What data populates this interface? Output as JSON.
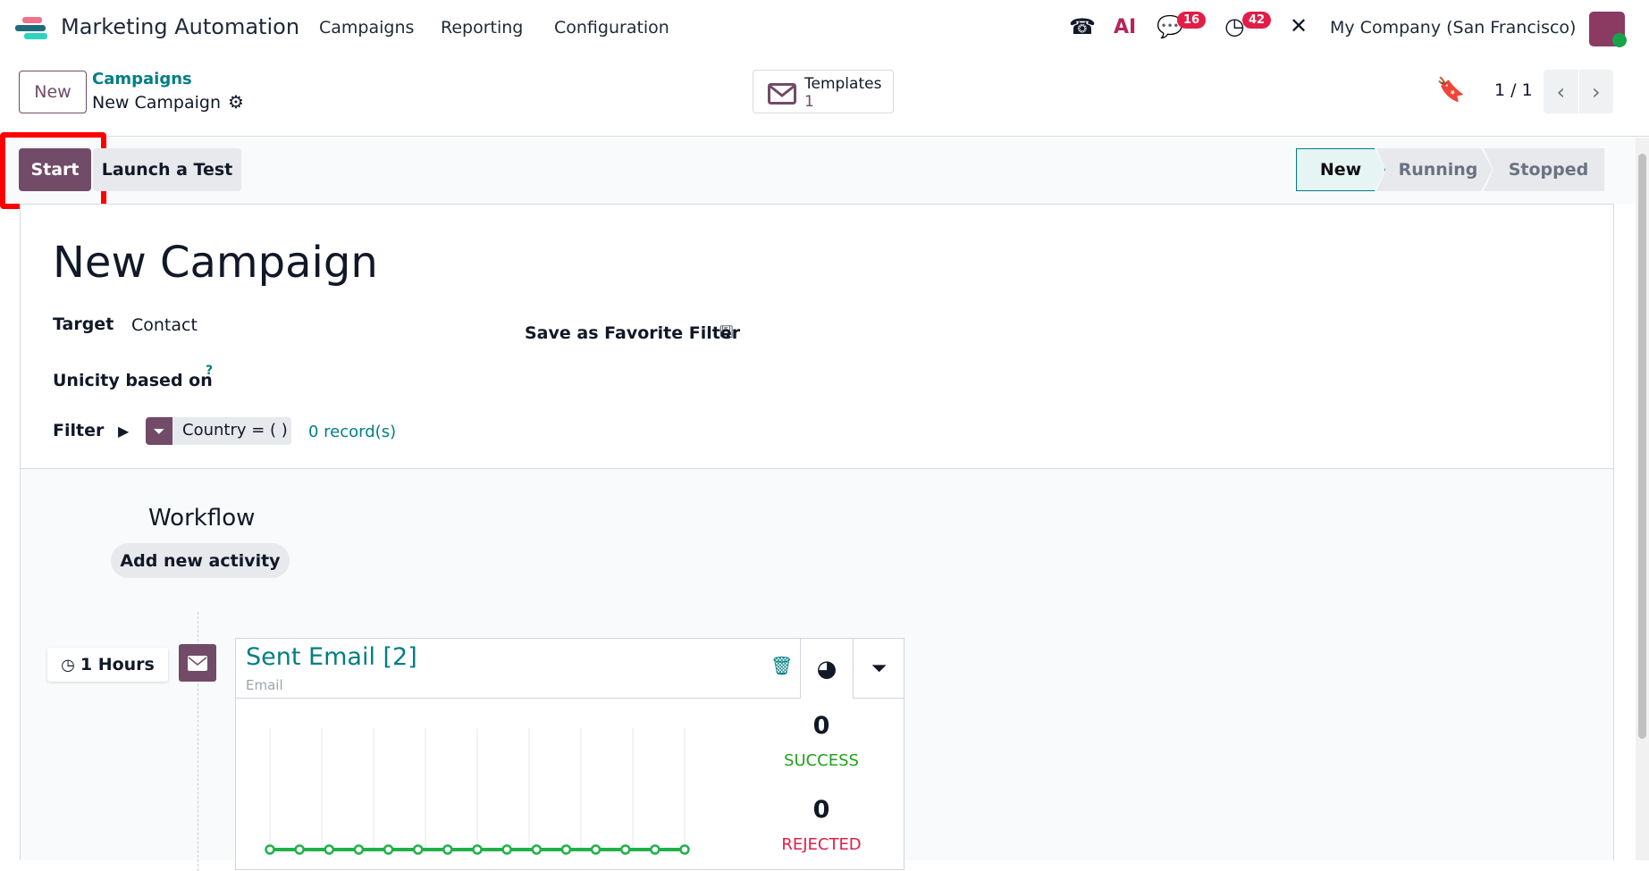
{
  "navbar": {
    "app_title": "Marketing Automation",
    "menu": [
      "Campaigns",
      "Reporting",
      "Configuration"
    ],
    "chat_badge": "16",
    "activity_badge": "42",
    "company": "My Company (San Francisco)",
    "ai_label": "AI"
  },
  "control_panel": {
    "new_label": "New",
    "breadcrumb_parent": "Campaigns",
    "breadcrumb_current": "New Campaign",
    "templates_label": "Templates",
    "templates_count": "1",
    "pager": "1 / 1"
  },
  "statusbar": {
    "start": "Start",
    "launch_test": "Launch a Test",
    "stages": [
      "New",
      "Running",
      "Stopped"
    ],
    "active_stage": "New"
  },
  "form": {
    "title": "New Campaign",
    "target_label": "Target",
    "target_value": "Contact",
    "favorite_filter": "Save as Favorite Filter",
    "unicity_label": "Unicity based on",
    "unicity_help": "?",
    "filter_label": "Filter",
    "filter_tag": "Country = ( )",
    "records": "0 record(s)"
  },
  "workflow": {
    "title": "Workflow",
    "add_activity": "Add new activity",
    "activity": {
      "delay": "1 Hours",
      "name": "Sent Email [2]",
      "type": "Email",
      "success_count": "0",
      "success_label": "SUCCESS",
      "rejected_count": "0",
      "rejected_label": "REJECTED"
    }
  },
  "chart_data": {
    "type": "line",
    "values": [
      0,
      0,
      0,
      0,
      0,
      0,
      0,
      0,
      0,
      0,
      0,
      0,
      0,
      0,
      0
    ],
    "color": "#21b14a"
  },
  "colors": {
    "brand": "#714b67",
    "teal": "#017e84",
    "success": "#21a11c",
    "danger": "#e11d48"
  }
}
